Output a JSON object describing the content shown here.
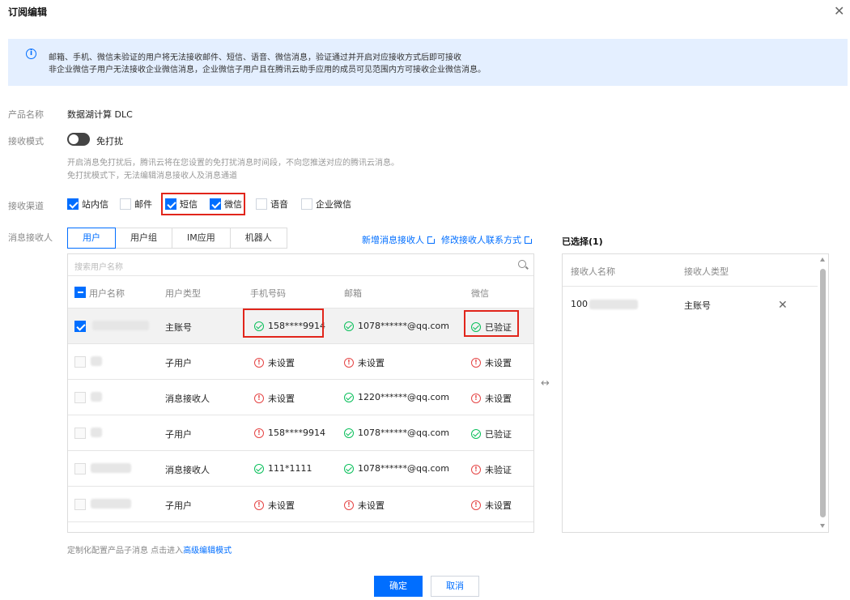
{
  "dialog": {
    "title": "订阅编辑"
  },
  "notice": {
    "icon": "info-icon",
    "line1": "邮箱、手机、微信未验证的用户将无法接收邮件、短信、语音、微信消息，验证通过并开启对应接收方式后即可接收",
    "line2": "非企业微信子用户无法接收企业微信消息，企业微信子用户且在腾讯云助手应用的成员可见范围内方可接收企业微信消息。"
  },
  "product": {
    "label": "产品名称",
    "value": "数据湖计算 DLC"
  },
  "mode": {
    "label": "接收模式",
    "toggle_label": "免打扰",
    "toggle_on": false,
    "hint1": "开启消息免打扰后，腾讯云将在您设置的免打扰消息时间段，不向您推送对应的腾讯云消息。",
    "hint2": "免打扰模式下，无法编辑消息接收人及消息通道"
  },
  "channels": {
    "label": "接收渠道",
    "items": [
      {
        "label": "站内信",
        "checked": true
      },
      {
        "label": "邮件",
        "checked": false
      },
      {
        "label": "短信",
        "checked": true
      },
      {
        "label": "微信",
        "checked": true
      },
      {
        "label": "语音",
        "checked": false
      },
      {
        "label": "企业微信",
        "checked": false
      }
    ]
  },
  "recipients": {
    "label": "消息接收人",
    "tabs": [
      "用户",
      "用户组",
      "IM应用",
      "机器人"
    ],
    "active_tab": "用户",
    "link_new": "新增消息接收人",
    "link_edit": "修改接收人联系方式",
    "search_placeholder": "搜索用户名称",
    "columns": [
      "用户名称",
      "用户类型",
      "手机号码",
      "邮箱",
      "微信"
    ],
    "rows": [
      {
        "selected": true,
        "type": "主账号",
        "phone": "158****9914",
        "phone_ok": true,
        "email": "1078******@qq.com",
        "email_ok": true,
        "wechat": "已验证",
        "wechat_ok": true
      },
      {
        "selected": false,
        "type": "子用户",
        "phone": "未设置",
        "phone_ok": false,
        "email": "未设置",
        "email_ok": false,
        "wechat": "未设置",
        "wechat_ok": false
      },
      {
        "selected": false,
        "type": "消息接收人",
        "phone": "未设置",
        "phone_ok": false,
        "email": "1220******@qq.com",
        "email_ok": true,
        "wechat": "未设置",
        "wechat_ok": false
      },
      {
        "selected": false,
        "type": "子用户",
        "phone": "158****9914",
        "phone_ok": false,
        "email": "1078******@qq.com",
        "email_ok": true,
        "wechat": "已验证",
        "wechat_ok": true
      },
      {
        "selected": false,
        "type": "消息接收人",
        "phone": "111*1111",
        "phone_ok": true,
        "email": "1078******@qq.com",
        "email_ok": true,
        "wechat": "未验证",
        "wechat_ok": false
      },
      {
        "selected": false,
        "type": "子用户",
        "phone": "未设置",
        "phone_ok": false,
        "email": "未设置",
        "email_ok": false,
        "wechat": "未设置",
        "wechat_ok": false
      }
    ]
  },
  "selected_panel": {
    "title": "已选择(1)",
    "columns": [
      "接收人名称",
      "接收人类型"
    ],
    "items": [
      {
        "name": "100",
        "type": "主账号"
      }
    ]
  },
  "footer": {
    "hint": "定制化配置产品子消息 点击进入",
    "link": "高级编辑模式",
    "confirm": "确定",
    "cancel": "取消"
  },
  "colors": {
    "accent": "#006eff",
    "success": "#0abf5b",
    "error": "#e54545",
    "highlight": "#e1251b"
  }
}
